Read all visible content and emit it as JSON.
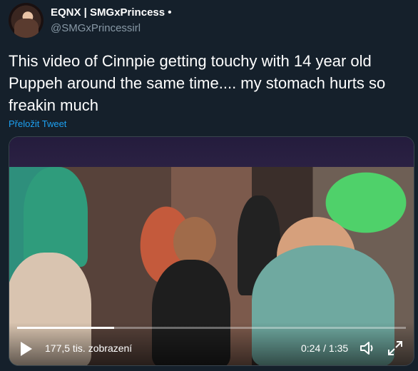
{
  "author": {
    "display_name": "EQNX | SMGxPrincess •",
    "handle": "@SMGxPrincessirl"
  },
  "tweet": {
    "text": "This video of Cinnpie getting touchy with 14 year old Puppeh around the same time.... my stomach hurts so freakin much",
    "translate_label": "Přeložit Tweet"
  },
  "video": {
    "views": "177,5 tis. zobrazení",
    "time": "0:24 / 1:35",
    "progress_fraction": 0.25
  }
}
